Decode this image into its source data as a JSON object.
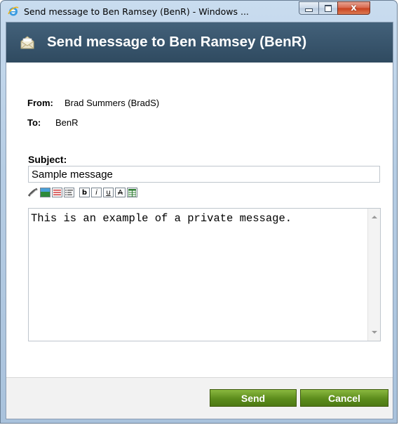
{
  "window": {
    "title": "Send message to Ben Ramsey (BenR) - Windows ...",
    "close_glyph": "x"
  },
  "header": {
    "title": "Send message to Ben Ramsey (BenR)",
    "icon": "envelope-icon"
  },
  "message": {
    "from_label": "From:",
    "from_value": "Brad Summers (BradS)",
    "to_label": "To:",
    "to_value": "BenR",
    "subject_label": "Subject:",
    "subject_value": "Sample message",
    "body_text": "This is an example of a private message."
  },
  "toolbar": {
    "items": [
      "link-icon",
      "image-icon",
      "bullet-list-icon",
      "numbered-list-icon",
      "bold-button",
      "italic-button",
      "underline-button",
      "strikethrough-button",
      "table-icon"
    ],
    "bold": "b",
    "italic": "i",
    "underline": "u",
    "strike": "A"
  },
  "footer": {
    "send_label": "Send",
    "cancel_label": "Cancel"
  },
  "colors": {
    "header_bg": "#3a566d",
    "button_green": "#5c8c1c",
    "window_frame": "#b6cde4"
  }
}
